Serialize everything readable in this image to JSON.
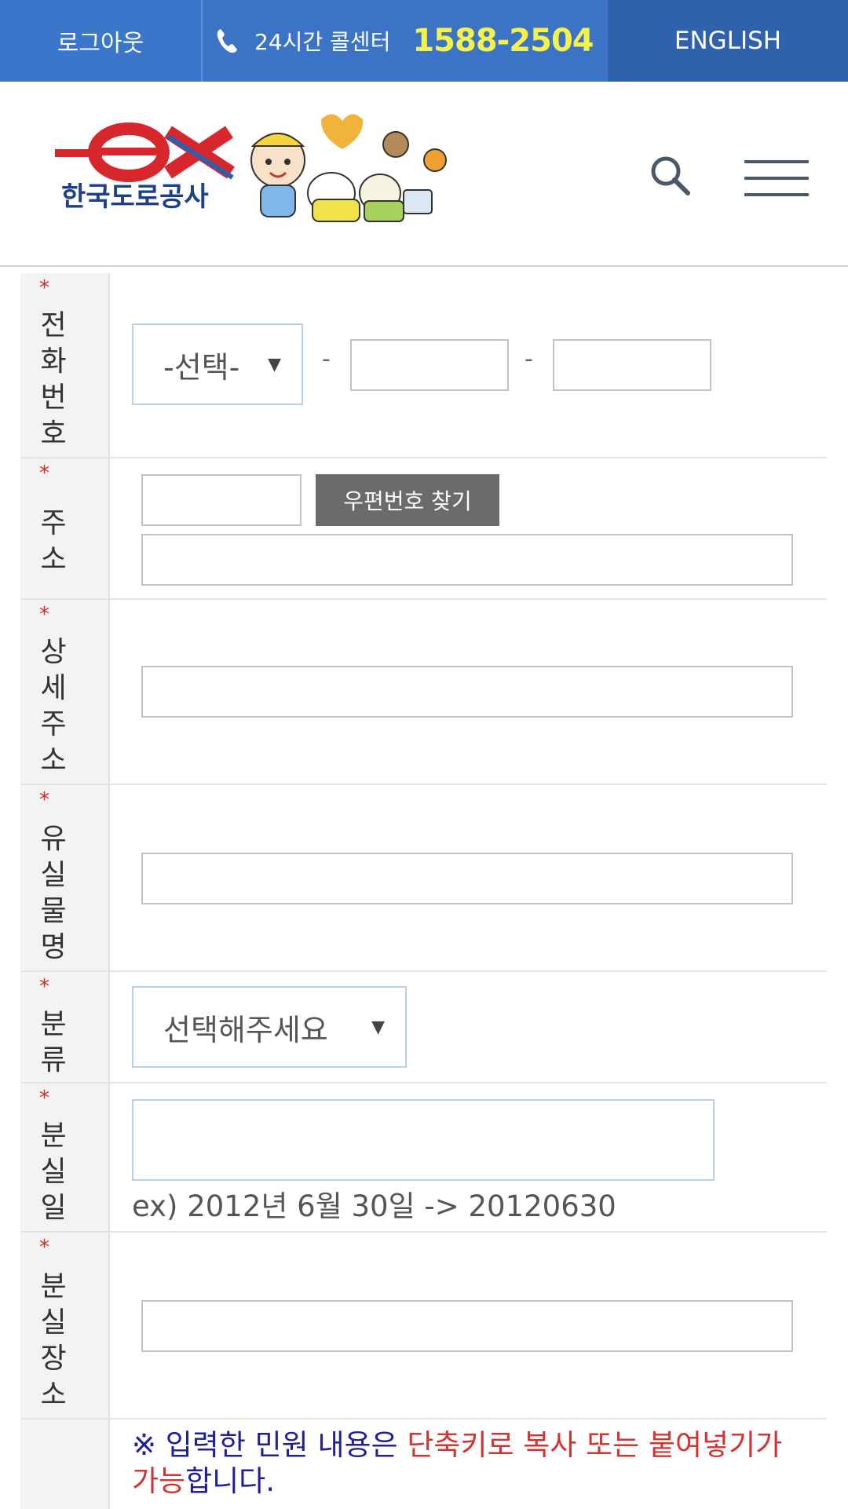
{
  "topbar": {
    "logout_label": "로그아웃",
    "callcenter_label": "24시간 콜센터",
    "callcenter_number": "1588-2504",
    "english_label": "ENGLISH"
  },
  "header": {
    "logo_text": "한국도로공사",
    "logo_mark": "ex"
  },
  "form": {
    "phone": {
      "label": "전화번호",
      "select_value": "-선택-",
      "dash": "-"
    },
    "address": {
      "label": "주소",
      "zip_button": "우편번호 찾기"
    },
    "detail_address": {
      "label": "상세주소"
    },
    "item_name": {
      "label": "유실물명"
    },
    "category": {
      "label": "분류",
      "select_value": "선택해주세요"
    },
    "lost_date": {
      "label": "분실일",
      "hint": "ex) 2012년 6월 30일 -> 20120630"
    },
    "lost_place": {
      "label": "분실장소"
    },
    "required_mark": "*"
  },
  "notice": {
    "prefix": "※ 입력한 민원 내용은 ",
    "highlight": "단축키로 복사 또는 붙여넣기가 가능",
    "suffix": "합니다."
  },
  "colors": {
    "topbar_bg": "#3b74c6",
    "phone_number": "#f6f04a",
    "required": "#d42b2b",
    "notice_blue": "#1f1f9a",
    "notice_red": "#d23333"
  }
}
